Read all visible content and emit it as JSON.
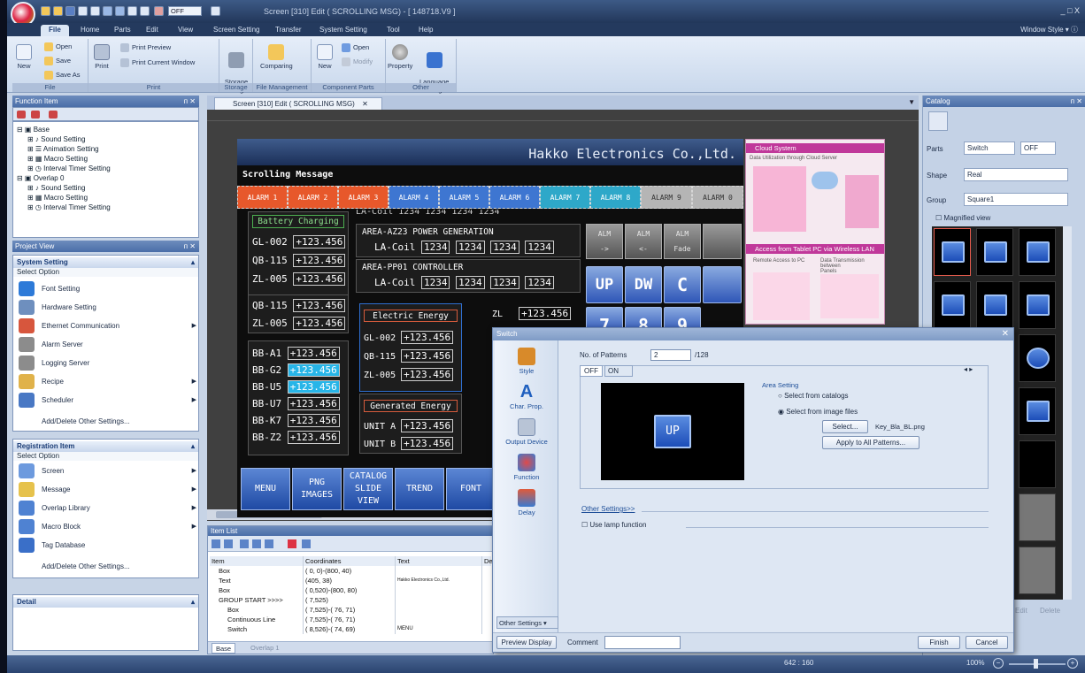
{
  "title_bar": {
    "title": "Screen [310] Edit (   SCROLLING MSG)  - [ 148718.V9 ]",
    "quick_access_value": "OFF",
    "window_controls": "_ □ X"
  },
  "menu": {
    "tabs": [
      "File",
      "Home",
      "Parts",
      "Edit",
      "View",
      "Screen Setting",
      "Transfer",
      "System Setting",
      "Tool",
      "Help"
    ],
    "window_style": "Window Style  ▾  ⓘ"
  },
  "ribbon": {
    "file": {
      "new": "New",
      "open": "Open",
      "save": "Save",
      "save_as": "Save As",
      "label": "File"
    },
    "print": {
      "print": "Print",
      "print_preview": "Print Preview",
      "print_current": "Print Current Window",
      "label": "Print"
    },
    "storage": {
      "manager": "Storage\nManager",
      "label": "Storage"
    },
    "file_mgmt": {
      "comparing": "Comparing",
      "label": "File Management"
    },
    "component": {
      "new": "New",
      "open": "Open",
      "modify": "Modify",
      "label": "Component Parts"
    },
    "other": {
      "property": "Property",
      "language": "Language\nSetting ▾",
      "label": "Other"
    }
  },
  "function_item": {
    "title": "Function Item",
    "tree": [
      {
        "text": "Base",
        "level": 0
      },
      {
        "text": "Sound Setting",
        "level": 1
      },
      {
        "text": "Animation Setting",
        "level": 1
      },
      {
        "text": "Macro Setting",
        "level": 1
      },
      {
        "text": "Interval Timer Setting",
        "level": 1
      },
      {
        "text": "Overlap  0",
        "level": 0
      },
      {
        "text": "Sound Setting",
        "level": 1
      },
      {
        "text": "Macro Setting",
        "level": 1
      },
      {
        "text": "Interval Timer Setting",
        "level": 1
      }
    ]
  },
  "project_view": {
    "title": "Project View",
    "system_setting": {
      "head": "System Setting",
      "sub": "Select Option",
      "options": [
        "Font Setting",
        "Hardware Setting",
        "Ethernet Communication",
        "Alarm Server",
        "Logging Server",
        "Recipe",
        "Scheduler"
      ],
      "add": "Add/Delete Other Settings..."
    },
    "registration": {
      "head": "Registration Item",
      "sub": "Select Option",
      "options": [
        "Screen",
        "Message",
        "Overlap Library",
        "Macro Block",
        "Tag Database"
      ],
      "add": "Add/Delete Other Settings..."
    },
    "detail": "Detail"
  },
  "document_tab": "Screen [310] Edit (   SCROLLING MSG)",
  "screen": {
    "company": "Hakko Electronics Co.,Ltd.",
    "scrolling_title": "Scrolling Message",
    "alarms": [
      "ALARM 1",
      "ALARM 2",
      "ALARM 3",
      "ALARM 4",
      "ALARM 5",
      "ALARM 6",
      "ALARM 7",
      "ALARM 8",
      "ALARM 9",
      "ALARM 0"
    ],
    "battery": "Battery Charging",
    "battery_rows": [
      {
        "tag": "GL-002",
        "val": "+123.456"
      },
      {
        "tag": "QB-115",
        "val": "+123.456"
      },
      {
        "tag": "ZL-005",
        "val": "+123.456"
      }
    ],
    "mid_rows": [
      {
        "tag": "QB-115",
        "val": "+123.456"
      },
      {
        "tag": "ZL-005",
        "val": "+123.456"
      }
    ],
    "bb_rows": [
      {
        "tag": "BB-A1",
        "val": "+123.456",
        "hi": false
      },
      {
        "tag": "BB-G2",
        "val": "+123.456",
        "hi": true
      },
      {
        "tag": "BB-U5",
        "val": "+123.456",
        "hi": true
      },
      {
        "tag": "BB-U7",
        "val": "+123.456",
        "hi": false
      },
      {
        "tag": "BB-K7",
        "val": "+123.456",
        "hi": false
      },
      {
        "tag": "BB-Z2",
        "val": "+123.456",
        "hi": false
      }
    ],
    "area_top_text": "LA-Coil  1234  1234  1234  1234",
    "area_az23": "AREA-AZ23 POWER GENERATION",
    "area_pp01": "AREA-PP01 CONTROLLER",
    "la_coil": "LA-Coil",
    "coil_val": "1234",
    "electric": "Electric Energy",
    "electric_rows": [
      {
        "tag": "GL-002",
        "val": "+123.456"
      },
      {
        "tag": "QB-115",
        "val": "+123.456"
      },
      {
        "tag": "ZL-005",
        "val": "+123.456"
      }
    ],
    "generated": "Generated Energy",
    "unit_rows": [
      {
        "tag": "UNIT A",
        "val": "+123.456"
      },
      {
        "tag": "UNIT B",
        "val": "+123.456"
      }
    ],
    "zl": "ZL",
    "zl_val": "+123.456",
    "alm": [
      {
        "label": "ALM",
        "sub": "->"
      },
      {
        "label": "ALM",
        "sub": "<-"
      },
      {
        "label": "ALM",
        "sub": "Fade"
      }
    ],
    "keys": [
      "UP",
      "DW",
      "C",
      "7",
      "8",
      "9"
    ],
    "nav": [
      "MENU",
      "PNG\nIMAGES",
      "CATALOG\nSLIDE\nVIEW",
      "TREND",
      "FONT"
    ],
    "cloud_title": "Cloud System",
    "cloud_sub": "Data Utilization through Cloud Server",
    "tablet_title": "Access from Tablet PC via Wireless LAN",
    "remote": "Remote Access to PC",
    "data_trans": "Data Transmission between\nPanels"
  },
  "catalog": {
    "title": "Catalog",
    "parts_label": "Parts",
    "parts_value": "Switch",
    "parts_value2": "OFF",
    "shape_label": "Shape",
    "shape_value": "Real",
    "group_label": "Group",
    "group_value": "Square1",
    "magnified": "Magnified view",
    "edit": "Edit",
    "delete": "Delete"
  },
  "item_list": {
    "title": "Item List",
    "columns": [
      "Item",
      "Coordinates",
      "Text",
      "De"
    ],
    "rows": [
      {
        "item": "Box",
        "coord": "(  0,  0)-(800, 40)",
        "text": ""
      },
      {
        "item": "Text",
        "coord": "(405, 38)",
        "text": "Hakko Electronics Co.,Ltd."
      },
      {
        "item": "Box",
        "coord": "(  0,520)-(800, 80)",
        "text": ""
      },
      {
        "item": "GROUP START >>>>",
        "coord": "(  7,525)",
        "text": ""
      },
      {
        "item": "Box",
        "coord": "(  7,525)-( 76, 71)",
        "text": ""
      },
      {
        "item": "Continuous Line",
        "coord": "(  7,525)-( 76, 71)",
        "text": ""
      },
      {
        "item": "Switch",
        "coord": "(  8,526)-( 74, 69)",
        "text": "MENU"
      }
    ],
    "tab_base": "Base",
    "tab_overlap": "Overlap 1"
  },
  "dialog": {
    "title": "Switch",
    "side": [
      "Style",
      "Char. Prop.",
      "Output Device",
      "Function",
      "Delay"
    ],
    "patterns_label": "No. of Patterns",
    "patterns_value": "2",
    "patterns_max": "/128",
    "tab_off": "OFF",
    "tab_on": "ON",
    "area_setting": "Area Setting",
    "opt_catalog": "Select from catalogs",
    "opt_image": "Select from image files",
    "select_btn": "Select...",
    "file_name": "Key_Bla_BL.png",
    "apply_btn": "Apply to All Patterns...",
    "preview_key": "UP",
    "other_settings_link": "Other Settings>>",
    "use_lamp": "Use lamp function",
    "other_settings_btn": "Other Settings  ▾",
    "preview_display": "Preview Display",
    "comment_label": "Comment",
    "finish": "Finish",
    "cancel": "Cancel"
  },
  "status": {
    "coords": "642 : 160",
    "zoom": "100%"
  }
}
